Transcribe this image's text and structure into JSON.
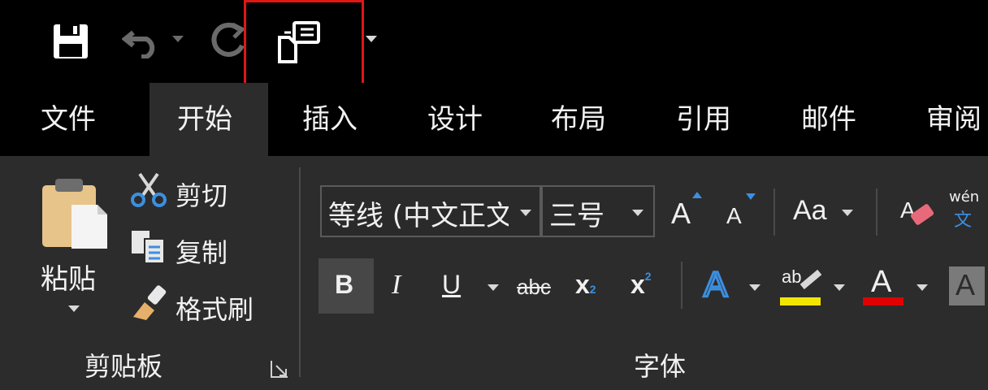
{
  "qat": {
    "save_icon": "save-icon",
    "undo_icon": "undo-icon",
    "redo_icon": "redo-icon",
    "touch_mode_icon": "touch-mouse-mode-icon",
    "customize_icon": "customize-qat-icon",
    "highlight_color": "#e01616"
  },
  "tabs": [
    {
      "label": "文件"
    },
    {
      "label": "开始",
      "active": true
    },
    {
      "label": "插入"
    },
    {
      "label": "设计"
    },
    {
      "label": "布局"
    },
    {
      "label": "引用"
    },
    {
      "label": "邮件"
    },
    {
      "label": "审阅"
    }
  ],
  "clipboard": {
    "paste_label": "粘贴",
    "cut_label": "剪切",
    "copy_label": "复制",
    "format_painter_label": "格式刷",
    "group_label": "剪贴板"
  },
  "font": {
    "font_name": "等线 (中文正文",
    "font_size": "三号",
    "grow_label": "A",
    "shrink_label": "A",
    "change_case_label": "Aa",
    "phonetic_top": "wén",
    "phonetic_bottom": "文",
    "bold": "B",
    "italic": "I",
    "underline": "U",
    "strike": "abc",
    "subscript": "x",
    "sub_mark": "2",
    "superscript": "x",
    "sup_mark": "2",
    "text_effect": "A",
    "highlight_text": "ab",
    "font_color": "A",
    "char_shading": "A",
    "group_label": "字体",
    "highlight_color": "#f2e600",
    "font_color_bar": "#e00000"
  }
}
